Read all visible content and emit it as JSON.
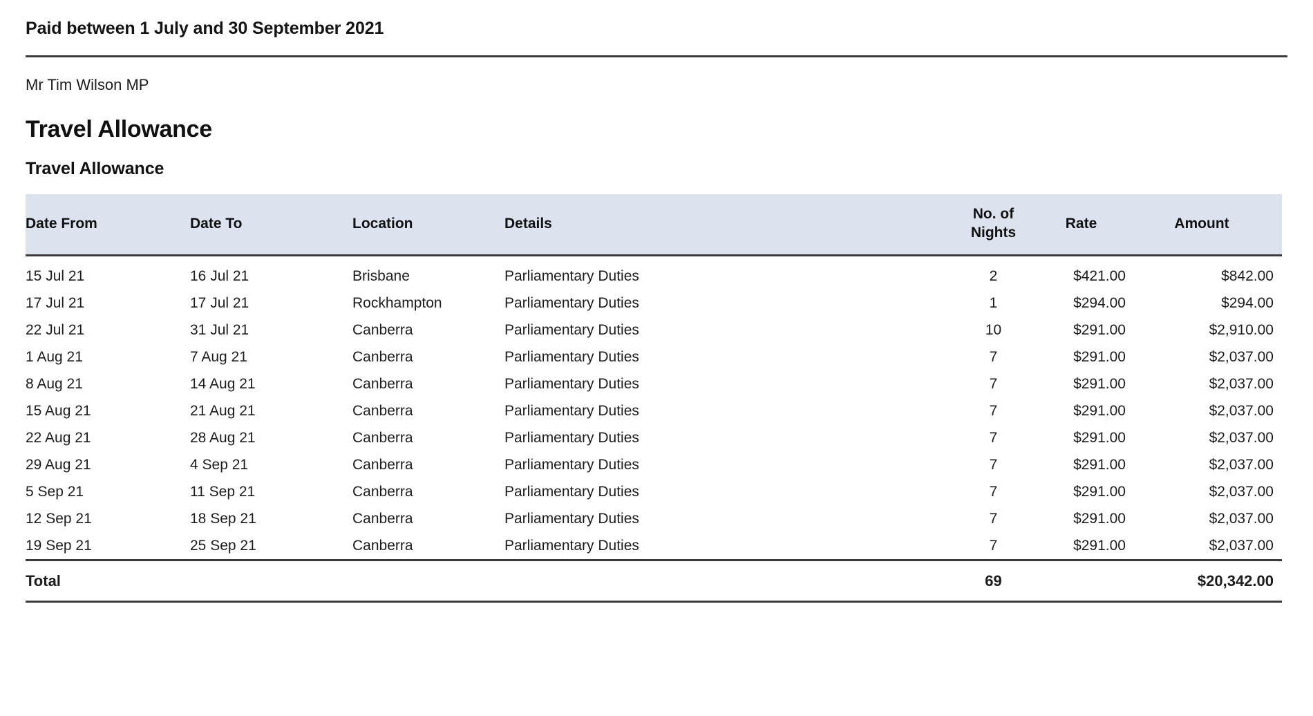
{
  "header": {
    "period": "Paid between 1 July and 30 September 2021",
    "member": "Mr Tim Wilson MP"
  },
  "section": {
    "title": "Travel Allowance",
    "subtitle": "Travel Allowance"
  },
  "colors": {
    "table_header_background": "#dce3ef",
    "rule": "#3a3a3a",
    "text": "#1c1c1c"
  },
  "table": {
    "columns": [
      "Date From",
      "Date To",
      "Location",
      "Details",
      "No. of Nights",
      "Rate",
      "Amount"
    ],
    "column_labels": {
      "date_from": "Date From",
      "date_to": "Date To",
      "location": "Location",
      "details": "Details",
      "nights_line1": "No. of",
      "nights_line2": "Nights",
      "rate": "Rate",
      "amount": "Amount"
    },
    "rows": [
      {
        "date_from": "15 Jul 21",
        "date_to": "16 Jul 21",
        "location": "Brisbane",
        "details": "Parliamentary Duties",
        "nights": "2",
        "rate": "$421.00",
        "amount": "$842.00"
      },
      {
        "date_from": "17 Jul 21",
        "date_to": "17 Jul 21",
        "location": "Rockhampton",
        "details": "Parliamentary Duties",
        "nights": "1",
        "rate": "$294.00",
        "amount": "$294.00"
      },
      {
        "date_from": "22 Jul 21",
        "date_to": "31 Jul 21",
        "location": "Canberra",
        "details": "Parliamentary Duties",
        "nights": "10",
        "rate": "$291.00",
        "amount": "$2,910.00"
      },
      {
        "date_from": "1 Aug 21",
        "date_to": "7 Aug 21",
        "location": "Canberra",
        "details": "Parliamentary Duties",
        "nights": "7",
        "rate": "$291.00",
        "amount": "$2,037.00"
      },
      {
        "date_from": "8 Aug 21",
        "date_to": "14 Aug 21",
        "location": "Canberra",
        "details": "Parliamentary Duties",
        "nights": "7",
        "rate": "$291.00",
        "amount": "$2,037.00"
      },
      {
        "date_from": "15 Aug 21",
        "date_to": "21 Aug 21",
        "location": "Canberra",
        "details": "Parliamentary Duties",
        "nights": "7",
        "rate": "$291.00",
        "amount": "$2,037.00"
      },
      {
        "date_from": "22 Aug 21",
        "date_to": "28 Aug 21",
        "location": "Canberra",
        "details": "Parliamentary Duties",
        "nights": "7",
        "rate": "$291.00",
        "amount": "$2,037.00"
      },
      {
        "date_from": "29 Aug 21",
        "date_to": "4 Sep 21",
        "location": "Canberra",
        "details": "Parliamentary Duties",
        "nights": "7",
        "rate": "$291.00",
        "amount": "$2,037.00"
      },
      {
        "date_from": "5 Sep 21",
        "date_to": "11 Sep 21",
        "location": "Canberra",
        "details": "Parliamentary Duties",
        "nights": "7",
        "rate": "$291.00",
        "amount": "$2,037.00"
      },
      {
        "date_from": "12 Sep 21",
        "date_to": "18 Sep 21",
        "location": "Canberra",
        "details": "Parliamentary Duties",
        "nights": "7",
        "rate": "$291.00",
        "amount": "$2,037.00"
      },
      {
        "date_from": "19 Sep 21",
        "date_to": "25 Sep 21",
        "location": "Canberra",
        "details": "Parliamentary Duties",
        "nights": "7",
        "rate": "$291.00",
        "amount": "$2,037.00"
      }
    ],
    "total": {
      "label": "Total",
      "nights": "69",
      "rate": "",
      "amount": "$20,342.00"
    }
  }
}
